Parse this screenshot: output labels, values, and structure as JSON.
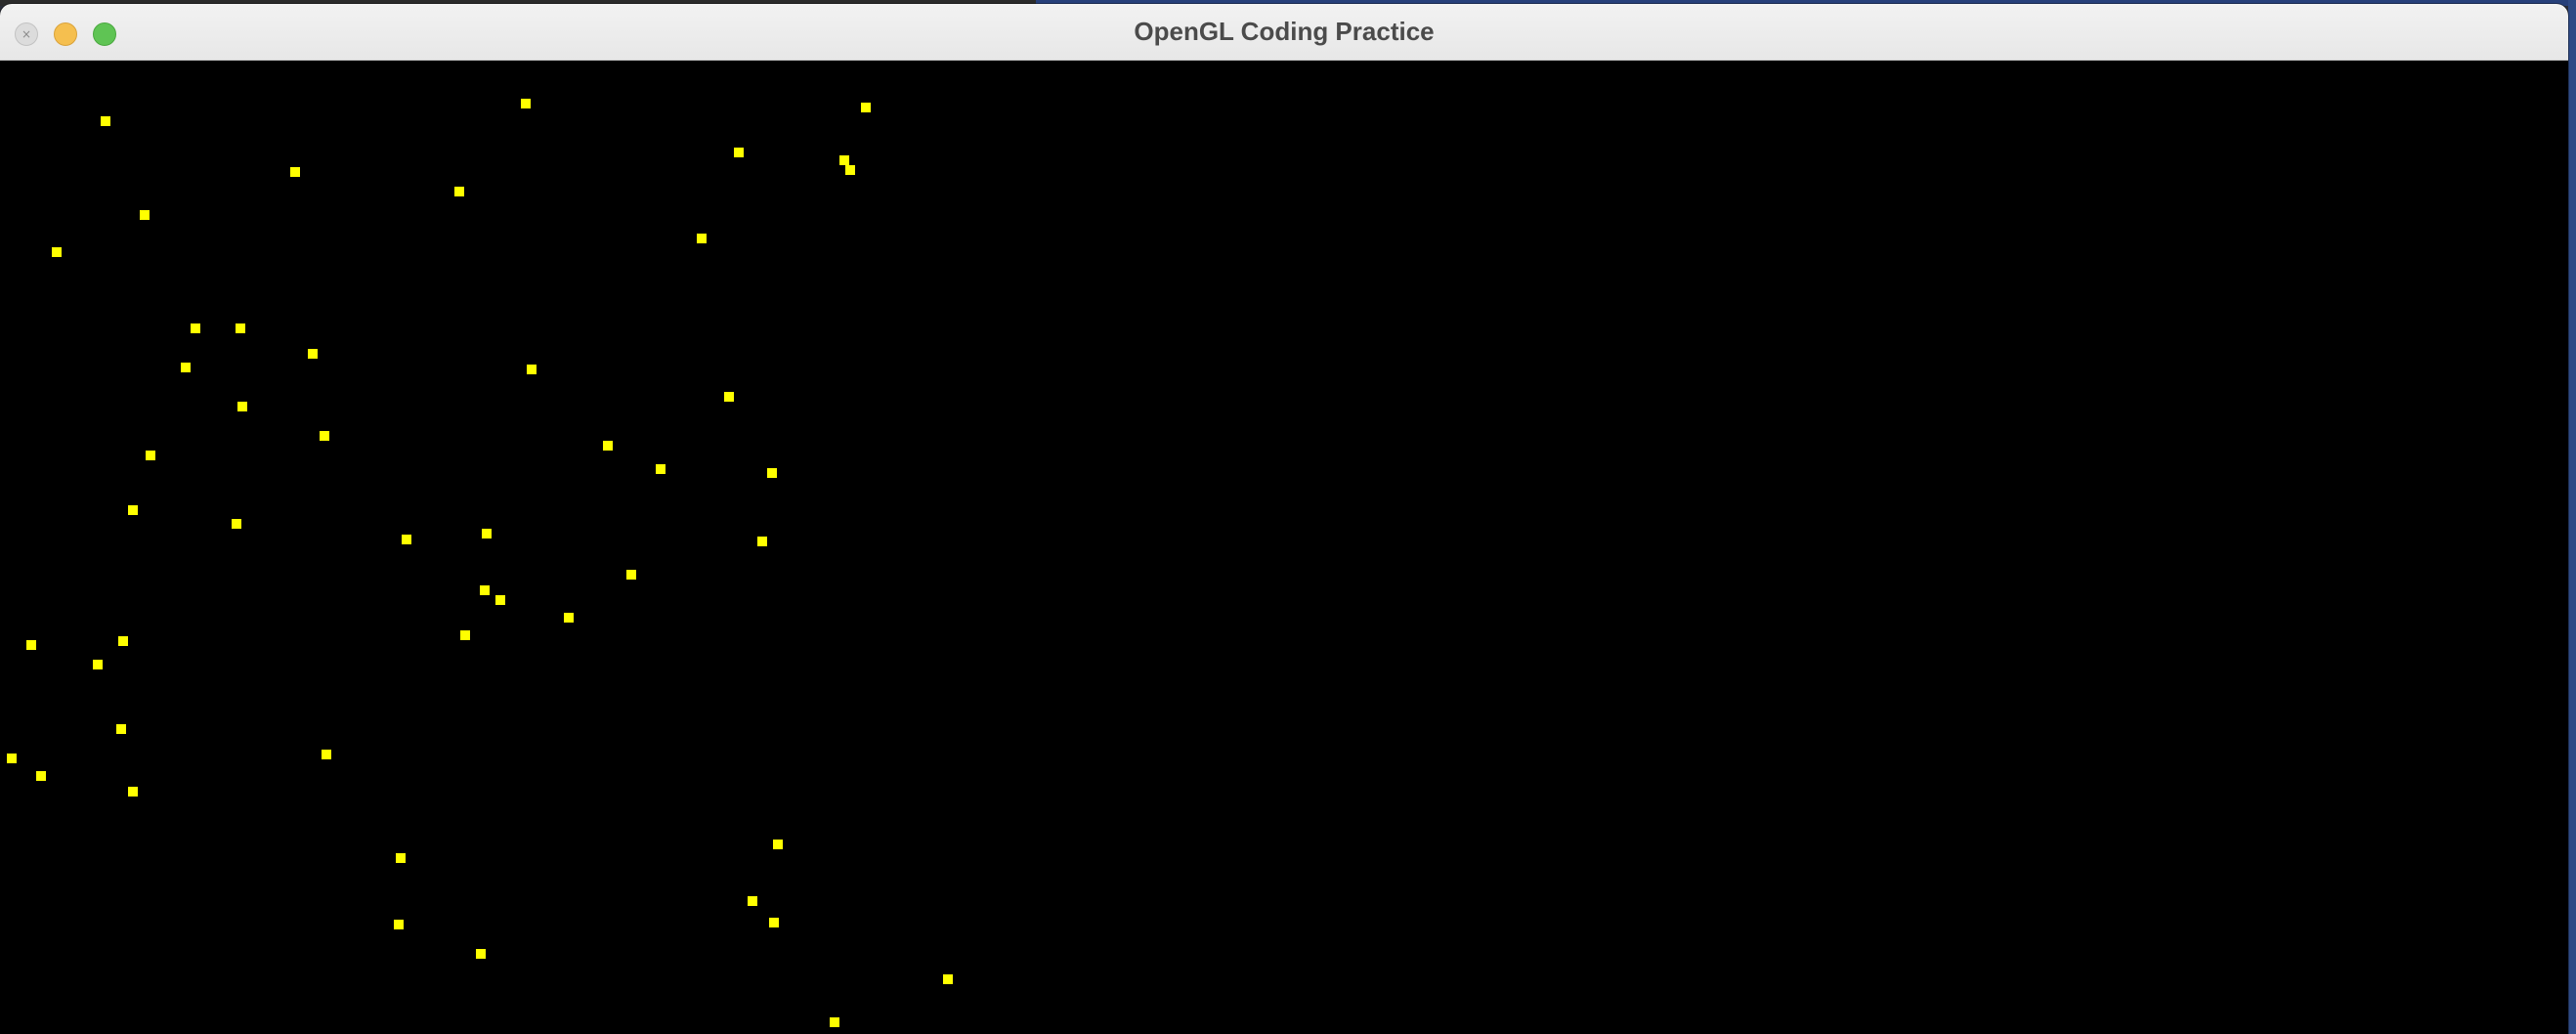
{
  "window": {
    "title": "OpenGL Coding Practice",
    "buttons": {
      "close_icon": "close-icon",
      "minimize_icon": "minimize-icon",
      "zoom_icon": "zoom-icon"
    }
  },
  "canvas": {
    "background_color": "#000000",
    "point_color": "#ffff00",
    "point_count": 52
  }
}
